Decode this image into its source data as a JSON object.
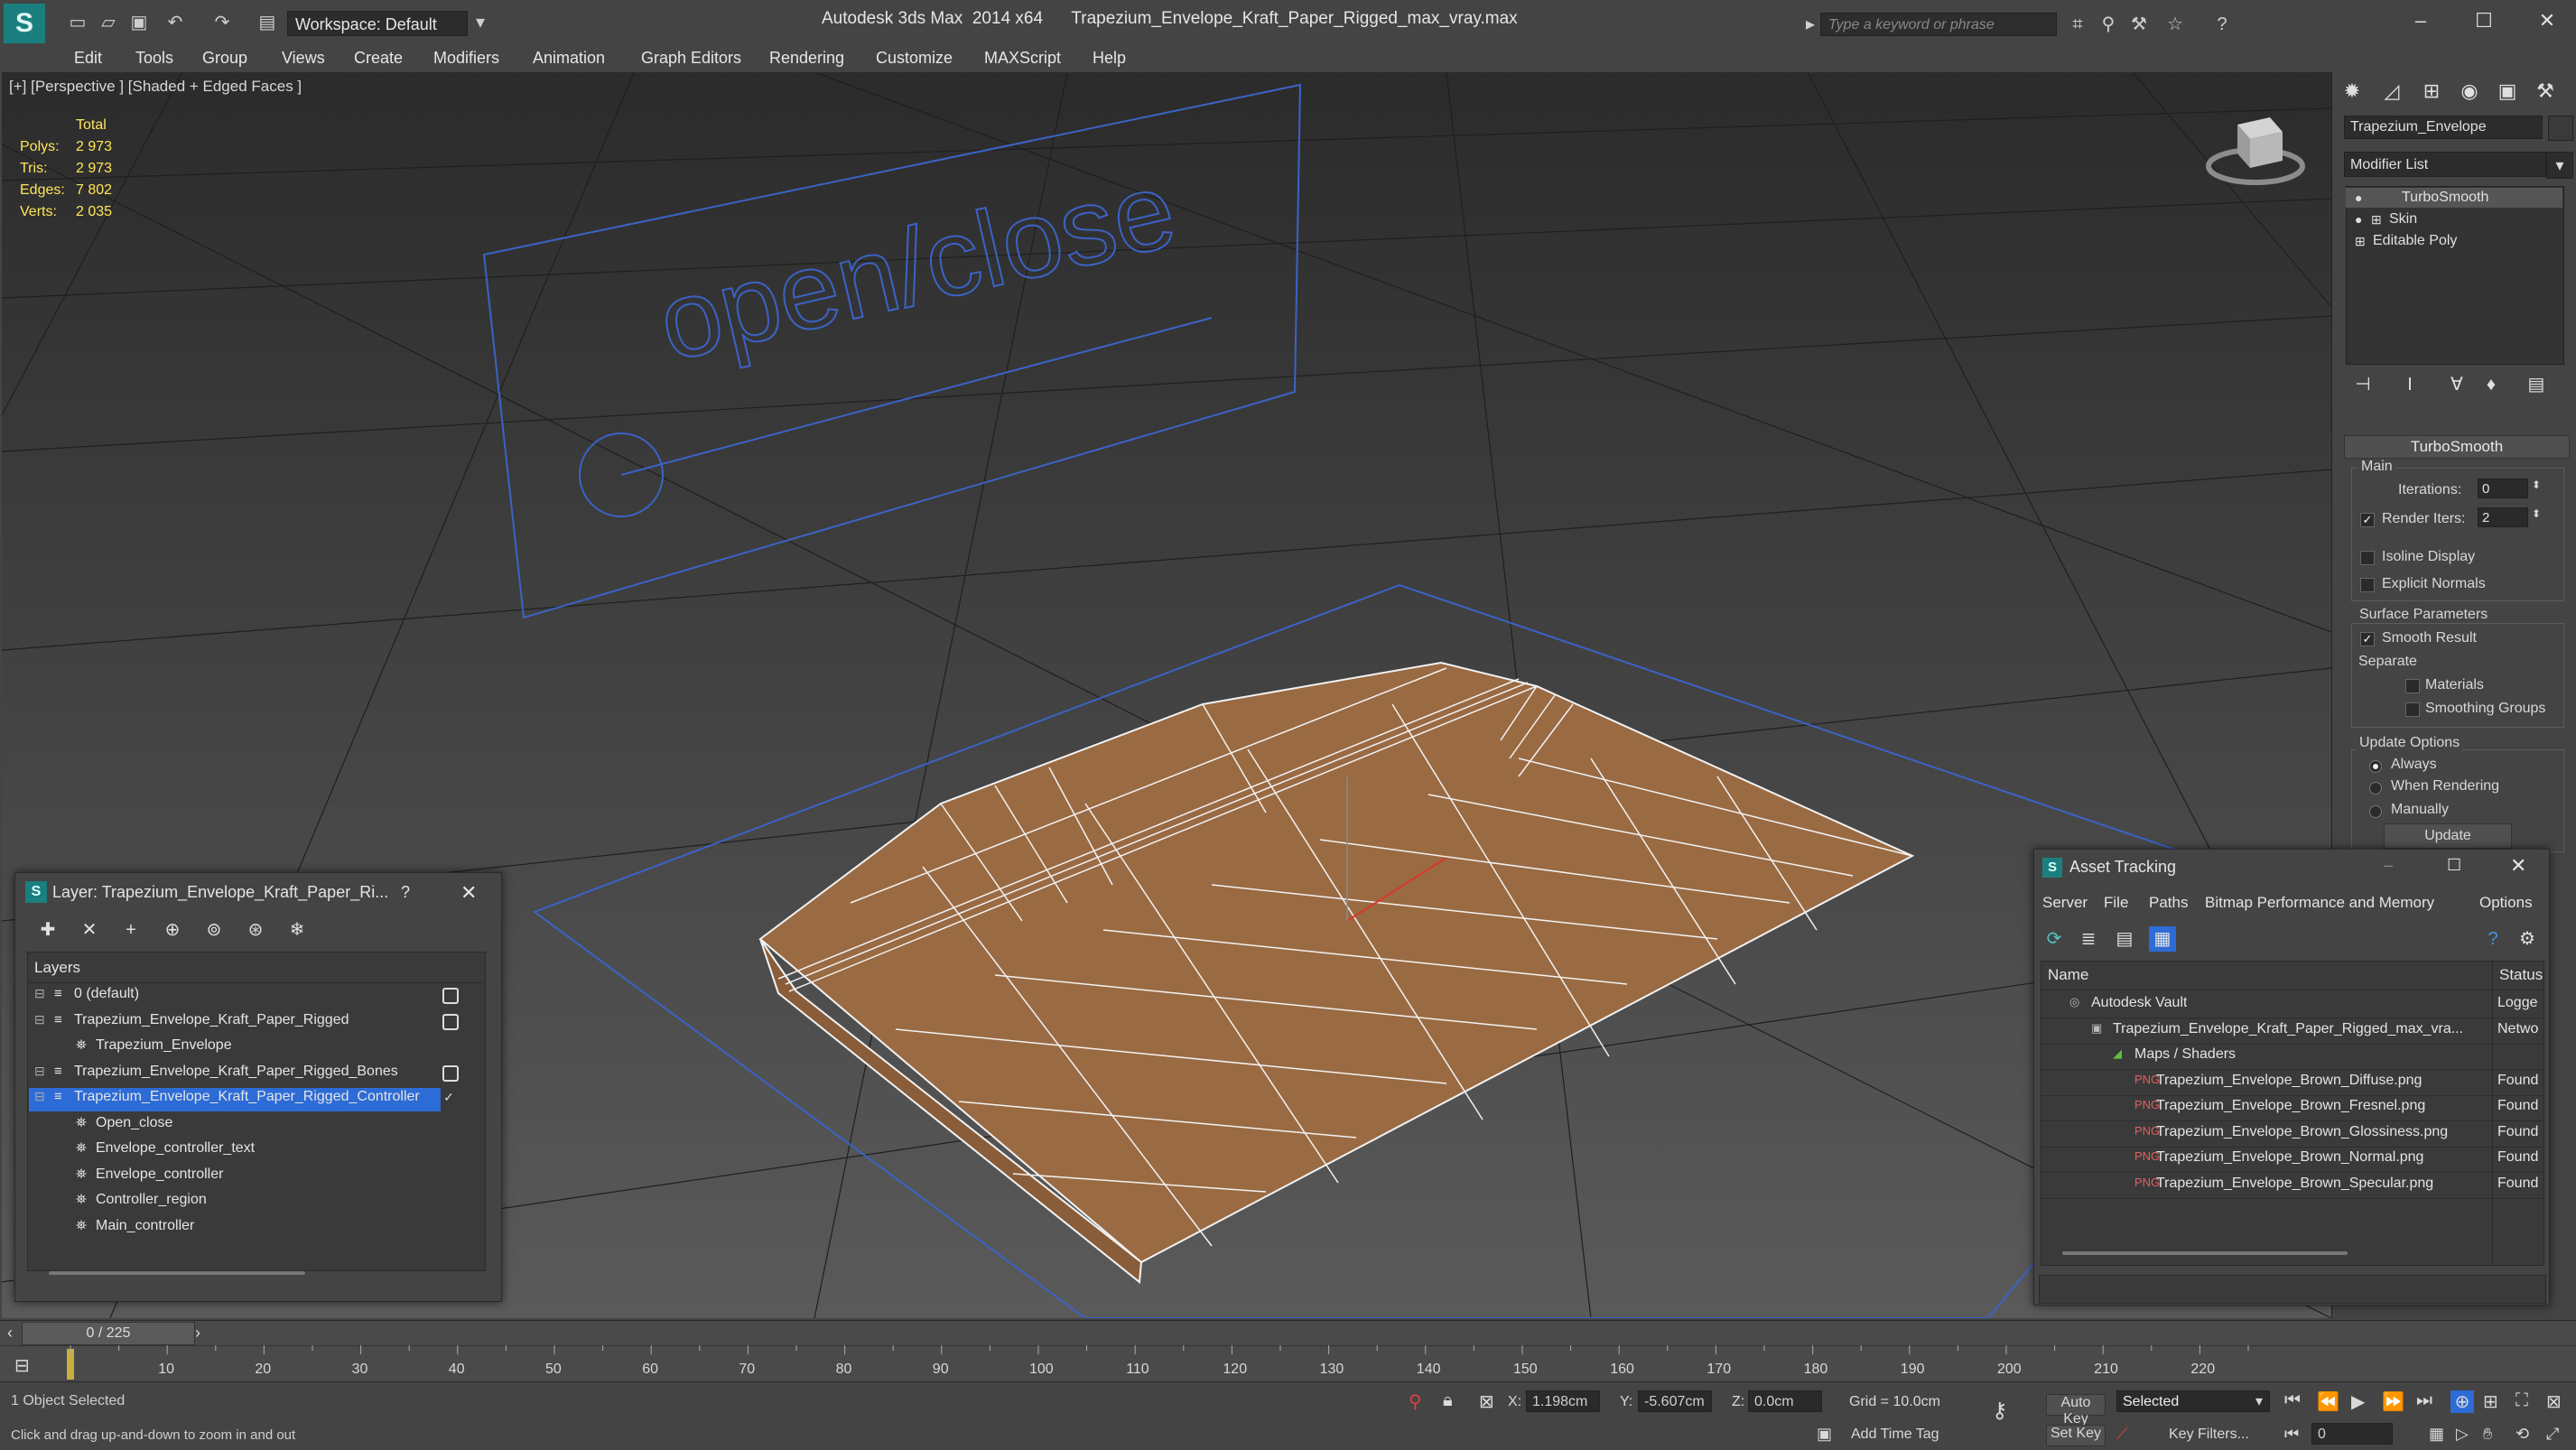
{
  "app": {
    "name": "Autodesk 3ds Max  2014 x64",
    "file": "Trapezium_Envelope_Kraft_Paper_Rigged_max_vray.max",
    "workspace": "Workspace: Default",
    "search_placeholder": "Type a keyword or phrase"
  },
  "menu": [
    "Edit",
    "Tools",
    "Group",
    "Views",
    "Create",
    "Modifiers",
    "Animation",
    "Graph Editors",
    "Rendering",
    "Customize",
    "MAXScript",
    "Help"
  ],
  "viewport": {
    "label": "[+] [Perspective ] [Shaded + Edged Faces ]",
    "stats": {
      "header": "Total",
      "rows": [
        {
          "label": "Polys:",
          "value": "2 973"
        },
        {
          "label": "Tris:",
          "value": "2 973"
        },
        {
          "label": "Edges:",
          "value": "7 802"
        },
        {
          "label": "Verts:",
          "value": "2 035"
        }
      ]
    },
    "shape_text": "open/close"
  },
  "command_panel": {
    "object_name": "Trapezium_Envelope",
    "modifier_list": "Modifier List",
    "stack": [
      "TurboSmooth",
      "Skin",
      "Editable Poly"
    ],
    "rollout": {
      "title": "TurboSmooth",
      "main_label": "Main",
      "iterations_label": "Iterations:",
      "iterations_value": "0",
      "render_iters_label": "Render Iters:",
      "render_iters_value": "2",
      "isoline_display": "Isoline Display",
      "explicit_normals": "Explicit Normals",
      "surface_params": "Surface Parameters",
      "smooth_result": "Smooth Result",
      "separate": "Separate",
      "materials": "Materials",
      "smoothing_groups": "Smoothing Groups",
      "update_options": "Update Options",
      "always": "Always",
      "when_rendering": "When Rendering",
      "manually": "Manually",
      "update_button": "Update"
    }
  },
  "layer_dialog": {
    "title": "Layer: Trapezium_Envelope_Kraft_Paper_Ri...",
    "help": "?",
    "column": "Layers",
    "rows": [
      {
        "text": "0 (default)",
        "indent": 0,
        "checkbox": true,
        "selected": false
      },
      {
        "text": "Trapezium_Envelope_Kraft_Paper_Rigged",
        "indent": 0,
        "checkbox": true,
        "selected": false
      },
      {
        "text": "Trapezium_Envelope",
        "indent": 1,
        "checkbox": false,
        "selected": false
      },
      {
        "text": "Trapezium_Envelope_Kraft_Paper_Rigged_Bones",
        "indent": 0,
        "checkbox": true,
        "selected": false
      },
      {
        "text": "Trapezium_Envelope_Kraft_Paper_Rigged_Controller",
        "indent": 0,
        "checkbox": false,
        "selected": true
      },
      {
        "text": "Open_close",
        "indent": 1,
        "checkbox": false,
        "selected": false
      },
      {
        "text": "Envelope_controller_text",
        "indent": 1,
        "checkbox": false,
        "selected": false
      },
      {
        "text": "Envelope_controller",
        "indent": 1,
        "checkbox": false,
        "selected": false
      },
      {
        "text": "Controller_region",
        "indent": 1,
        "checkbox": false,
        "selected": false
      },
      {
        "text": "Main_controller",
        "indent": 1,
        "checkbox": false,
        "selected": false
      }
    ]
  },
  "asset_dialog": {
    "title": "Asset Tracking",
    "menu": [
      "Server",
      "File",
      "Paths",
      "Bitmap Performance and Memory",
      "Options"
    ],
    "col_name": "Name",
    "col_status": "Status",
    "rows": [
      {
        "name": "Autodesk Vault",
        "status": "Logge",
        "indent": 1
      },
      {
        "name": "Trapezium_Envelope_Kraft_Paper_Rigged_max_vra...",
        "status": "Netwo",
        "indent": 2
      },
      {
        "name": "Maps / Shaders",
        "status": "",
        "indent": 3
      },
      {
        "name": "Trapezium_Envelope_Brown_Diffuse.png",
        "status": "Found",
        "indent": 4
      },
      {
        "name": "Trapezium_Envelope_Brown_Fresnel.png",
        "status": "Found",
        "indent": 4
      },
      {
        "name": "Trapezium_Envelope_Brown_Glossiness.png",
        "status": "Found",
        "indent": 4
      },
      {
        "name": "Trapezium_Envelope_Brown_Normal.png",
        "status": "Found",
        "indent": 4
      },
      {
        "name": "Trapezium_Envelope_Brown_Specular.png",
        "status": "Found",
        "indent": 4
      }
    ]
  },
  "timeline": {
    "frame": "0 / 225",
    "ticks": [
      "10",
      "20",
      "30",
      "40",
      "50",
      "60",
      "70",
      "80",
      "90",
      "100",
      "110",
      "120",
      "130",
      "140",
      "150",
      "160",
      "170",
      "180",
      "190",
      "200",
      "210",
      "220"
    ]
  },
  "status": {
    "selection": "1 Object Selected",
    "prompt": "Click and drag up-and-down to zoom in and out",
    "x_label": "X:",
    "x": "1.198cm",
    "y_label": "Y:",
    "y": "-5.607cm",
    "z_label": "Z:",
    "z": "0.0cm",
    "grid": "Grid = 10.0cm",
    "add_time_tag": "Add Time Tag",
    "auto_key": "Auto Key",
    "set_key": "Set Key",
    "selected": "Selected",
    "key_filters": "Key Filters...",
    "frame_value": "0"
  },
  "colors": {
    "envelope": "#9a6a43",
    "wire": "#f2f2f2",
    "shape": "#3b63c6",
    "selection": "#2d6bd6"
  }
}
